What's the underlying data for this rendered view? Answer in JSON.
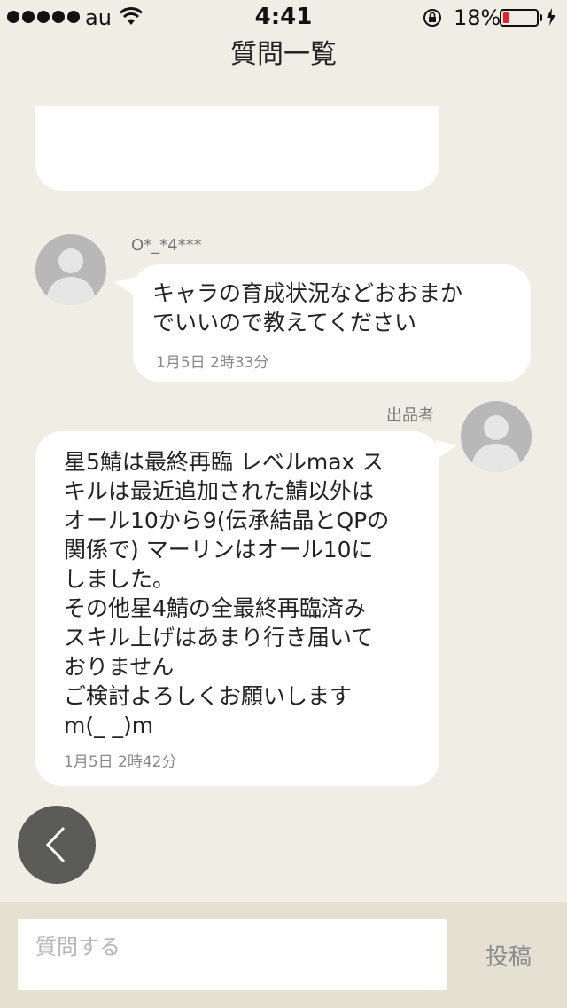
{
  "status_bar": {
    "carrier": "au",
    "time": "4:41",
    "battery_percent": "18%",
    "battery_level": 0.18,
    "battery_color": "#e8202a",
    "signal_icon": "signal-dots-icon",
    "wifi_icon": "wifi-icon",
    "rotation_lock_icon": "rotation-lock-icon",
    "charging_icon": "bolt-icon"
  },
  "nav": {
    "title": "質問一覧"
  },
  "messages": [
    {
      "sender": "O*_*4***",
      "text": "キャラの育成状況などおおまか\nでいいので教えてください",
      "time": "1月5日 2時33分"
    },
    {
      "sender": "出品者",
      "text": "星5鯖は最終再臨 レベルmax ス\nキルは最近追加された鯖以外は\nオール10から9(伝承結晶とQPの\n関係で) マーリンはオール10に\nしました。\nその他星4鯖の全最終再臨済み\nスキル上げはあまり行き届いて\nおりません\nご検討よろしくお願いします\nm(_ _)m",
      "time": "1月5日 2時42分"
    }
  ],
  "back_icon": "chevron-left-icon",
  "composer": {
    "placeholder": "質問する",
    "value": "",
    "submit_label": "投稿"
  }
}
